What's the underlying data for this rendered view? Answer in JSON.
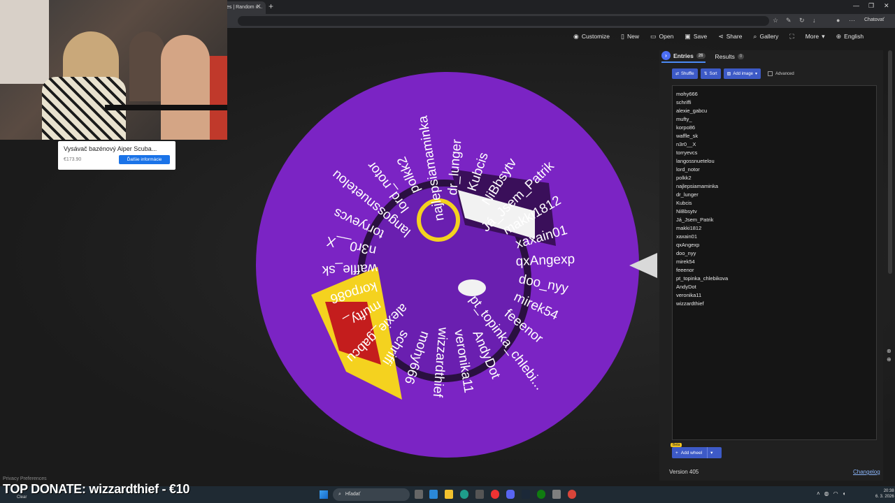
{
  "browser": {
    "tab_title": "es | Random n...",
    "chatovat": "Chatovať"
  },
  "menu": {
    "customize": "Customize",
    "new": "New",
    "open": "Open",
    "save": "Save",
    "share": "Share",
    "gallery": "Gallery",
    "more": "More",
    "language": "English"
  },
  "ad": {
    "title": "Vysávač bazénový Aiper Scuba...",
    "price": "€173.90",
    "button": "Ďalšie informácie"
  },
  "sidebar": {
    "tab_entries": "Entries",
    "entries_count": "26",
    "tab_results": "Results",
    "results_count": "0",
    "shuffle": "Shuffle",
    "sort": "Sort",
    "add_image": "Add image",
    "advanced": "Advanced",
    "entries": [
      "mohy666",
      "schriffi",
      "alexie_gabcu",
      "mufty_",
      "korpo86",
      "waffle_sk",
      "n3r0__X",
      "torryevcs",
      "langossnuetelou",
      "lord_notor",
      "polkk2",
      "najlepsiamaminka",
      "dr_lunger",
      "Kubcis",
      "NiBbsytv",
      "Já_Jsem_Patrik",
      "makki1812",
      "xaxain01",
      "qxAngexp",
      "doo_nyy",
      "mirek54",
      "feeenor",
      "pt_topinka_chlebikova",
      "AndyDot",
      "veronika11",
      "wizzardthief"
    ],
    "beta": "Beta",
    "add_wheel": "Add wheel",
    "version": "Version 405",
    "changelog": "Changelog"
  },
  "wheel": {
    "color": "#7b24c4",
    "labels": [
      "mohy666",
      "schriffi",
      "alexie_gabcu",
      "mufty_",
      "korpo86",
      "waffle_sk",
      "n3r0__X",
      "torryevcs",
      "langossnuetelou",
      "lord_notor",
      "polkk2",
      "najlepsiamaminka",
      "dr_lunger",
      "Kubcis",
      "NiBbsytv",
      "Já_Jsem_Patrik",
      "makki1812",
      "xaxain01",
      "qxAngexp",
      "doo_nyy",
      "mirek54",
      "feeenor",
      "pt_topinka_chlebi...",
      "AndyDot",
      "veronika11",
      "wizzardthief"
    ]
  },
  "overlay": {
    "privacy": "Privacy Preferences",
    "top_donate": "TOP DONATE: wizzardthief - €10",
    "clear": "Clear"
  },
  "taskbar": {
    "search": "Hľadať",
    "time": "20:38",
    "date": "6. 3. 2026"
  }
}
